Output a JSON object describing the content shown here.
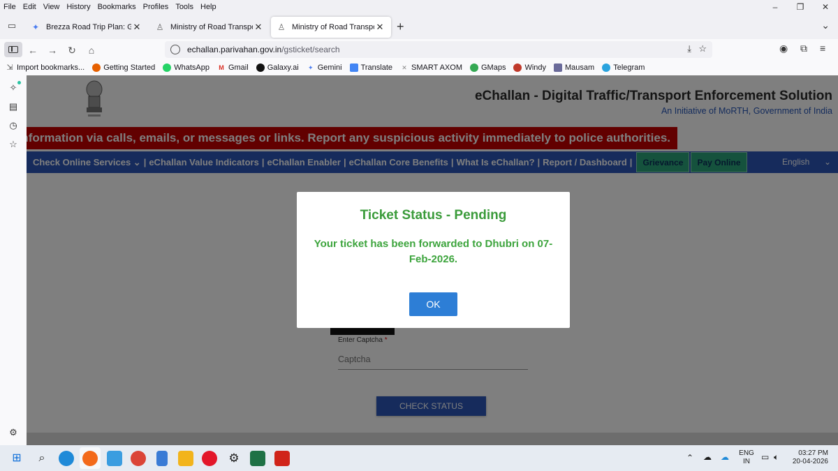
{
  "menu": [
    "File",
    "Edit",
    "View",
    "History",
    "Bookmarks",
    "Profiles",
    "Tools",
    "Help"
  ],
  "window_controls": {
    "minimize": "–",
    "restore": "❐",
    "close": "✕"
  },
  "tabs": [
    {
      "title": "Brezza Road Trip Plan: Guwahati",
      "icon": "gemini-sparkle-icon",
      "active": false
    },
    {
      "title": "Ministry of Road Transport and",
      "icon": "emblem-icon",
      "active": false
    },
    {
      "title": "Ministry of Road Transport and",
      "icon": "emblem-icon",
      "active": true
    }
  ],
  "address_bar": {
    "domain": "echallan.parivahan.gov.in",
    "path": "/gsticket/search"
  },
  "bookmarks": [
    {
      "label": "Import bookmarks...",
      "color": "#555555"
    },
    {
      "label": "Getting Started",
      "color": "#e66000"
    },
    {
      "label": "WhatsApp",
      "color": "#25d366"
    },
    {
      "label": "Gmail",
      "color": "#d93025"
    },
    {
      "label": "Galaxy.ai",
      "color": "#111111"
    },
    {
      "label": "Gemini",
      "color": "#4a7cf0"
    },
    {
      "label": "Translate",
      "color": "#4285f4"
    },
    {
      "label": "SMART AXOM",
      "color": "#888888"
    },
    {
      "label": "GMaps",
      "color": "#34a853"
    },
    {
      "label": "Windy",
      "color": "#c0392b"
    },
    {
      "label": "Mausam",
      "color": "#6a6a9a"
    },
    {
      "label": "Telegram",
      "color": "#2aa3de"
    }
  ],
  "site": {
    "title": "eChallan - Digital Traffic/Transport Enforcement Solution",
    "subtitle": "An Initiative of MoRTH, Government of India",
    "marquee": "onal information via calls, emails, or messages or links. Report any suspicious activity immediately to police authorities."
  },
  "nav": {
    "items": [
      "Check Online Services ⌄",
      "eChallan Value Indicators",
      "eChallan Enabler",
      "eChallan Core Benefits",
      "What Is eChallan?",
      "Report / Dashboard"
    ],
    "grievance": "Grievance",
    "pay_online": "Pay Online",
    "language": "English"
  },
  "form": {
    "captcha_label": "Enter Captcha",
    "captcha_required": "*",
    "captcha_placeholder": "Captcha",
    "check_button": "CHECK STATUS"
  },
  "modal": {
    "title": "Ticket Status - Pending",
    "message": "Your ticket has been forwarded to Dhubri on 07-Feb-2026.",
    "ok_button": "OK"
  },
  "tray": {
    "lang_line1": "ENG",
    "lang_line2": "IN"
  },
  "clock": {
    "time": "03:27 PM",
    "date": "20-04-2026"
  }
}
